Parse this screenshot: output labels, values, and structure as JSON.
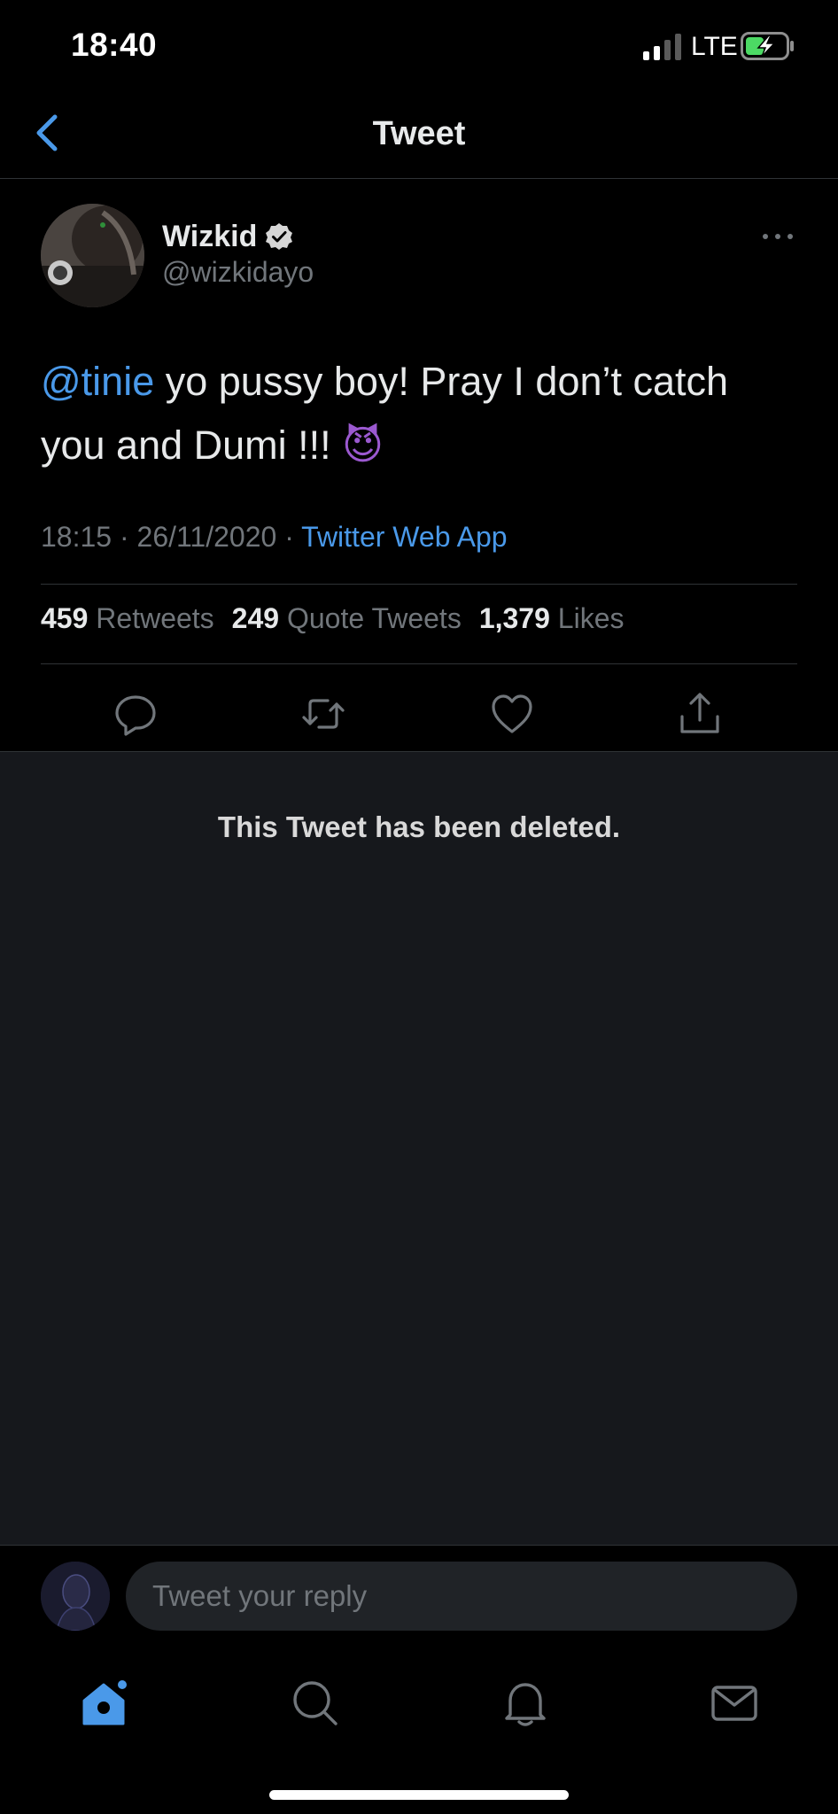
{
  "status_bar": {
    "time": "18:40",
    "network": "LTE"
  },
  "nav": {
    "title": "Tweet"
  },
  "tweet": {
    "author_name": "Wizkid",
    "author_handle": "@wizkidayo",
    "mention": "@tinie",
    "text": " yo pussy boy! Pray I don’t catch you and Dumi !!! ",
    "emoji": "😈",
    "timestamp": "18:15 · 26/11/2020 · ",
    "source": "Twitter Web App",
    "stats": {
      "retweets_count": "459",
      "retweets_label": "Retweets",
      "quotes_count": "249",
      "quotes_label": "Quote Tweets",
      "likes_count": "1,379",
      "likes_label": "Likes"
    }
  },
  "deleted": {
    "message": "This Tweet has been deleted."
  },
  "reply": {
    "placeholder": "Tweet your reply",
    "value": ""
  },
  "colors": {
    "accent": "#4a99e9",
    "background": "#000000",
    "panel": "#16181c",
    "muted": "#71767b"
  },
  "icons": [
    "back-chevron-icon",
    "verified-icon",
    "more-icon",
    "reply-icon",
    "retweet-icon",
    "like-icon",
    "share-icon",
    "home-icon",
    "search-icon",
    "notifications-icon",
    "messages-icon"
  ]
}
